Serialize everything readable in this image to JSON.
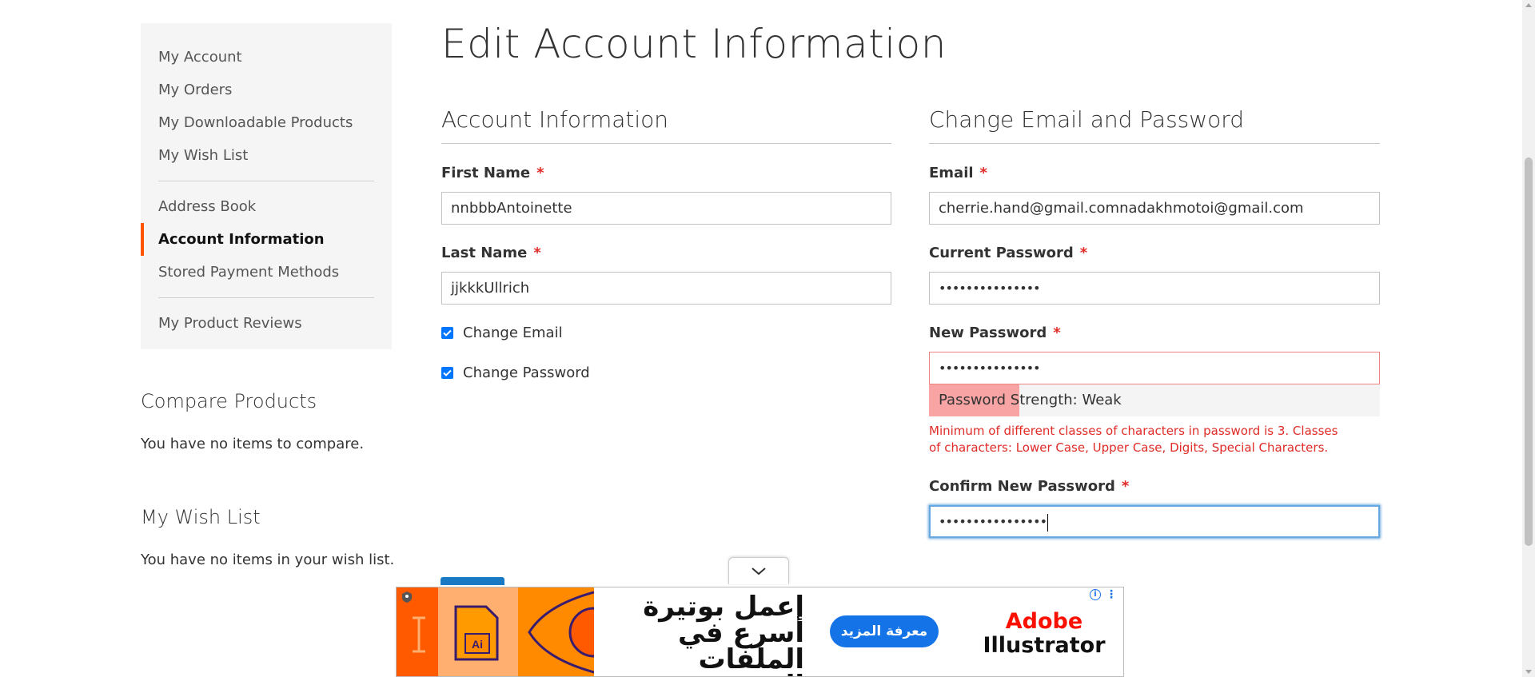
{
  "sidebar": {
    "group1": [
      {
        "label": "My Account"
      },
      {
        "label": "My Orders"
      },
      {
        "label": "My Downloadable Products"
      },
      {
        "label": "My Wish List"
      }
    ],
    "group2": [
      {
        "label": "Address Book"
      },
      {
        "label": "Account Information",
        "current": true
      },
      {
        "label": "Stored Payment Methods"
      }
    ],
    "group3": [
      {
        "label": "My Product Reviews"
      }
    ]
  },
  "compare": {
    "title": "Compare Products",
    "empty_text": "You have no items to compare."
  },
  "wishlist": {
    "title": "My Wish List",
    "empty_text": "You have no items in your wish list."
  },
  "page_title": "Edit Account Information",
  "account_info": {
    "title": "Account Information",
    "first_name": {
      "label": "First Name",
      "required_mark": "*",
      "value": "nnbbbAntoinette"
    },
    "last_name": {
      "label": "Last Name",
      "required_mark": "*",
      "value": "jjkkkUllrich"
    },
    "change_email": {
      "label": "Change Email",
      "checked": true
    },
    "change_password": {
      "label": "Change Password",
      "checked": true
    }
  },
  "change_email_password": {
    "title": "Change Email and Password",
    "email": {
      "label": "Email",
      "required_mark": "*",
      "value": "cherrie.hand@gmail.comnadakhmotoi@gmail.com"
    },
    "current_password": {
      "label": "Current Password",
      "required_mark": "*",
      "masked_value": "•••••••••••••••"
    },
    "new_password": {
      "label": "New Password",
      "required_mark": "*",
      "masked_value": "•••••••••••••••"
    },
    "strength": {
      "text": "Password Strength: Weak",
      "level": 0.2,
      "color": "#f9a4a4"
    },
    "error": "Minimum of different classes of characters in password is 3. Classes of characters: Lower Case, Upper Case, Digits, Special Characters.",
    "confirm_password": {
      "label": "Confirm New Password",
      "required_mark": "*",
      "masked_value": "••••••••••••••••"
    }
  },
  "ad": {
    "arabic_headline": "اعمل بوتيرة أسرع في الملفات المعقدة.",
    "cta": "معرفة المزيد",
    "brand_line1": "Adobe",
    "brand_line2": "Illustrator",
    "product_icon_text": "Ai"
  },
  "colors": {
    "accent": "#ff5501",
    "error": "#e02b27",
    "focus": "#68a8e0",
    "checkbox": "#0075ff",
    "cta": "#1473e6"
  }
}
